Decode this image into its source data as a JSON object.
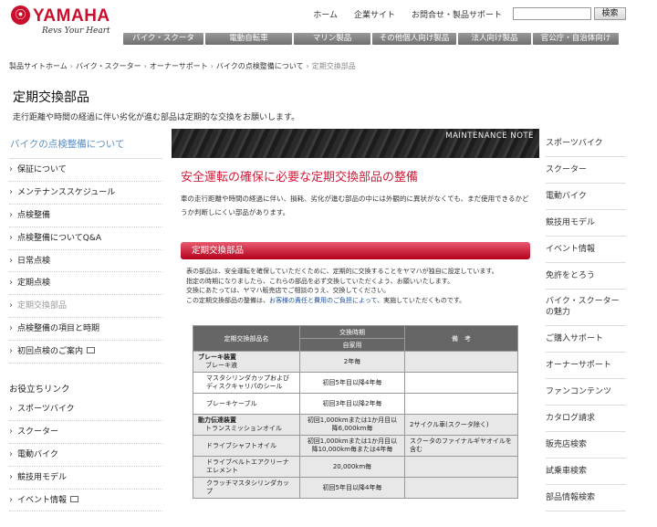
{
  "header": {
    "logo_mark": "⦿",
    "logo_word": "YAMAHA",
    "slogan": "Revs Your Heart",
    "util_links": [
      "ホーム",
      "企業サイト",
      "お問合せ・製品サポート"
    ],
    "search_placeholder": "",
    "search_button": "検索",
    "global_nav": [
      "バイク・スクーター",
      "電動自転車",
      "マリン製品",
      "その他個人向け製品",
      "法人向け製品",
      "官公庁・自治体向け製品"
    ]
  },
  "breadcrumb": [
    "製品サイトホーム",
    "バイク・スクーター",
    "オーナーサポート",
    "バイクの点検整備について",
    "定期交換部品"
  ],
  "page": {
    "title": "定期交換部品",
    "description": "走行距離や時間の経過に伴い劣化が進む部品は定期的な交換をお願いします。"
  },
  "left_nav": {
    "heading": "バイクの点検整備について",
    "items": [
      "保証について",
      "メンテナンススケジュール",
      "点検整備",
      "点検整備についてQ&A",
      "日常点検",
      "定期点検",
      "定期交換部品",
      "点検整備の項目と時期",
      "初回点検のご案内"
    ]
  },
  "related": {
    "heading": "お役立ちリンク",
    "items": [
      "スポーツバイク",
      "スクーター",
      "電動バイク",
      "競技用モデル",
      "イベント情報"
    ]
  },
  "right_nav": [
    "スポーツバイク",
    "スクーター",
    "電動バイク",
    "競技用モデル",
    "イベント情報",
    "免許をとろう",
    "バイク・スクーターの魅力",
    "ご購入サポート",
    "オーナーサポート",
    "ファンコンテンツ",
    "カタログ請求",
    "販売店検索",
    "試乗車検索",
    "部品情報検索"
  ],
  "main": {
    "banner_text": "MAINTENANCE NOTE",
    "heading": "安全運転の確保に必要な定期交換部品の整備",
    "lead": "車の走行距離や時間の経過に伴い、損耗、劣化が進む部品の中には外観的に異状がなくても、まだ使用できるかどうか判断しにくい部品があります。",
    "section_title": "定期交換部品",
    "section_lines": [
      "表の部品は、安全運転を確保していただくために、定期的に交換することをヤマハが独自に設定しています。",
      "指定の時期になりましたら、これらの部品を必ず交換していただくよう、お願いいたします。",
      "交換にあたっては、ヤマハ販売店でご相談のうえ、交換してください。"
    ],
    "section_last_prefix": "この定期交換部品の整備は、",
    "section_last_em": "お客様の責任と費用のご負担によって",
    "section_last_suffix": "、実施していただくものです。"
  },
  "table": {
    "col_part": "定期交換部品名",
    "col_timing": "交換時期",
    "col_timing_sub": "自家用",
    "col_note": "備　考",
    "rows": [
      {
        "cat": "ブレーキ装置",
        "part": "ブレーキ液",
        "timing": "2年毎",
        "note": ""
      },
      {
        "cat": "",
        "part": "マスタシリンダカップおよびディスクキャリパのシール",
        "timing": "初回5年目以降4年毎",
        "note": ""
      },
      {
        "cat": "",
        "part": "ブレーキケーブル",
        "timing": "初回3年目以降2年毎",
        "note": ""
      },
      {
        "cat": "動力伝達装置",
        "part": "トランスミッションオイル",
        "timing": "初回1,000kmまたは1か月目以降6,000km毎",
        "note": "2サイクル車(スクータ除く)"
      },
      {
        "cat": "",
        "part": "ドライブシャフトオイル",
        "timing": "初回1,000kmまたは1か月目以降10,000km毎または4年毎",
        "note": "スクータのファイナルギヤオイルを含む"
      },
      {
        "cat": "",
        "part": "ドライブベルトエアクリーナエレメント",
        "timing": "20,000km毎",
        "note": ""
      },
      {
        "cat": "",
        "part": "クラッチマスタシリンダカップ",
        "timing": "初回5年目以降4年毎",
        "note": ""
      }
    ]
  }
}
